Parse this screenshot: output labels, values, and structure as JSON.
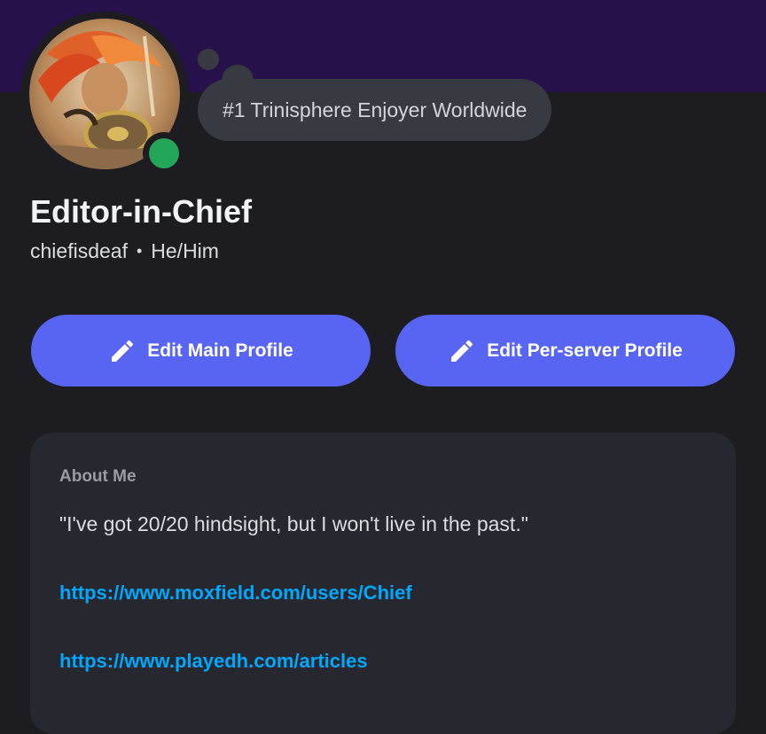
{
  "profile": {
    "custom_status": "#1 Trinisphere Enjoyer Worldwide",
    "display_name": "Editor-in-Chief",
    "username": "chiefisdeaf",
    "separator": "•",
    "pronouns": "He/Him",
    "online_status": "online",
    "avatar_icon": "avatar-image"
  },
  "actions": {
    "edit_main_label": "Edit Main Profile",
    "edit_server_label": "Edit Per-server Profile",
    "icon": "pencil-icon"
  },
  "about": {
    "heading": "About Me",
    "quote": "\"I've got 20/20 hindsight, but I won't live in the past.\"",
    "links": [
      "https://www.moxfield.com/users/Chief",
      "https://www.playedh.com/articles"
    ]
  },
  "colors": {
    "banner": "#26114b",
    "background": "#1c1c21",
    "button": "#5865f2",
    "online": "#23a55a",
    "link": "#00a8fc",
    "card": "#27282f"
  }
}
